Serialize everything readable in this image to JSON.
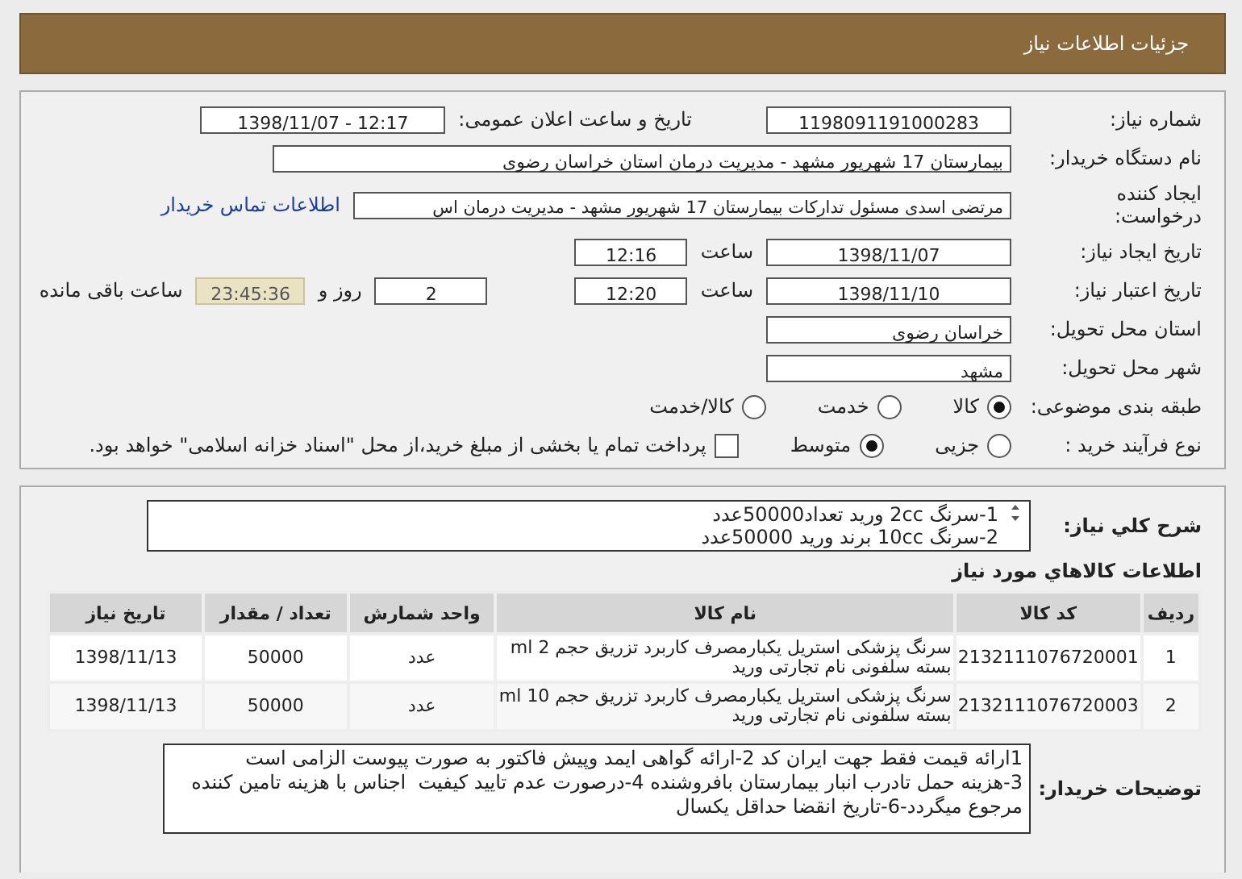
{
  "header": {
    "title": "جزئیات اطلاعات نیاز"
  },
  "form": {
    "need_number": {
      "label": "شماره نیاز:",
      "value": "1198091191000283"
    },
    "announce": {
      "label": "تاریخ و ساعت اعلان عمومی:",
      "value": "1398/11/07 - 12:17"
    },
    "buyer_org": {
      "label": "نام دستگاه خریدار:",
      "value": "بیمارستان 17 شهریور مشهد - مدیریت درمان استان خراسان رضوی"
    },
    "requester": {
      "label": "ایجاد کننده درخواست:",
      "value": "مرتضی اسدی مسئول تدارکات بیمارستان 17 شهریور مشهد - مدیریت درمان اس",
      "link": "اطلاعات تماس خریدار"
    },
    "creation": {
      "label": "تاریخ ایجاد نیاز:",
      "date": "1398/11/07",
      "time_label": "ساعت",
      "time": "12:16"
    },
    "validity": {
      "label": "تاریخ اعتبار نیاز:",
      "date": "1398/11/10",
      "time_label": "ساعت",
      "time": "12:20",
      "days": "2",
      "days_label": "روز و",
      "remaining": "23:45:36",
      "remaining_label": "ساعت باقی مانده"
    },
    "province": {
      "label": "استان محل تحویل:",
      "value": "خراسان رضوی"
    },
    "city": {
      "label": "شهر محل تحویل:",
      "value": "مشهد"
    },
    "category": {
      "label": "طبقه بندی موضوعی:",
      "options": [
        {
          "label": "کالا",
          "selected": true
        },
        {
          "label": "خدمت",
          "selected": false
        },
        {
          "label": "کالا/خدمت",
          "selected": false
        }
      ]
    },
    "process": {
      "label": "نوع فرآیند خرید :",
      "options": [
        {
          "label": "جزیی",
          "selected": false
        },
        {
          "label": "متوسط",
          "selected": true
        }
      ],
      "payment": {
        "label": "پرداخت تمام یا بخشی از مبلغ خرید،از محل \"اسناد خزانه اسلامی\" خواهد بود.",
        "checked": false
      }
    }
  },
  "description": {
    "label": "شرح كلي نياز:",
    "text": "1-سرنگ 2cc ورید تعداد50000عدد\n2-سرنگ 10cc برند ورید 50000عدد"
  },
  "items": {
    "title": "اطلاعات كالاهاي مورد نياز",
    "columns": [
      "ردیف",
      "کد کالا",
      "نام کالا",
      "واحد شمارش",
      "تعداد / مقدار",
      "تاریخ نیاز"
    ],
    "rows": [
      [
        "1",
        "2132111076720001",
        "سرنگ پزشکی استریل یکبارمصرف کاربرد تزریق حجم 2 ml\nبسته سلفونی نام تجارتی ورید",
        "عدد",
        "50000",
        "1398/11/13"
      ],
      [
        "2",
        "2132111076720003",
        "سرنگ پزشکی استریل یکبارمصرف کاربرد تزریق حجم 10 ml\nبسته سلفونی نام تجارتی ورید",
        "عدد",
        "50000",
        "1398/11/13"
      ]
    ]
  },
  "notes": {
    "label": "توضیحات خریدار:",
    "text": "1ارائه قیمت فقط جهت ایران کد 2-ارائه گواهی ایمد وپیش فاکتور به صورت پیوست الزامی است\n3-هزینه حمل تادرب انبار بیمارستان بافروشنده 4-درصورت عدم تایید کیفیت  اجناس با هزینه تامین کننده\nمرجوع میگردد-6-تاریخ انقضا حداقل یکسال"
  }
}
